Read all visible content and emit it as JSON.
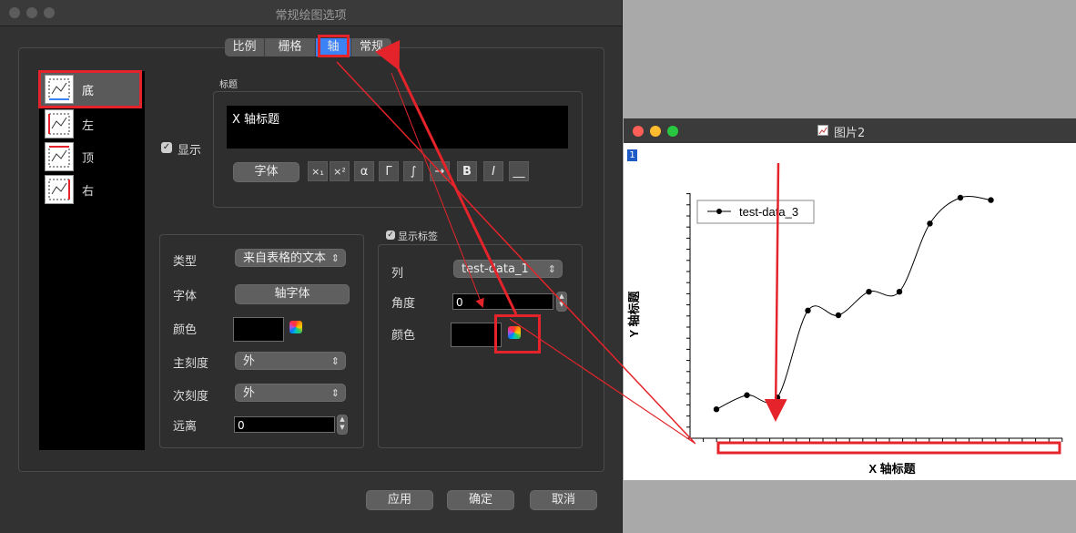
{
  "dialog": {
    "title": "常规绘图选项",
    "tabs": [
      {
        "label": "比例"
      },
      {
        "label": "栅格"
      },
      {
        "label": "轴",
        "selected": true
      },
      {
        "label": "常规"
      }
    ],
    "axes": [
      {
        "label": "底",
        "selected": true
      },
      {
        "label": "左"
      },
      {
        "label": "顶"
      },
      {
        "label": "右"
      }
    ],
    "show_checkbox": {
      "checked": true,
      "label": "显示"
    },
    "title_section": {
      "label": "标题",
      "text": "X 轴标题",
      "font_button": "字体",
      "toolbar": [
        "×₁",
        "×²",
        "α",
        "Γ",
        "∫",
        "→",
        "B",
        "I",
        "__"
      ]
    },
    "axis_props": {
      "type_label": "类型",
      "type_value": "来自表格的文本",
      "font_label": "字体",
      "font_button": "轴字体",
      "color_label": "颜色",
      "major_label": "主刻度",
      "major_value": "外",
      "minor_label": "次刻度",
      "minor_value": "外",
      "distance_label": "远离",
      "distance_value": "0"
    },
    "labels_section": {
      "checkbox_label": "显示标签",
      "checked": true,
      "column_label": "列",
      "column_value": "test-data_1",
      "angle_label": "角度",
      "angle_value": "0",
      "color_label": "颜色"
    },
    "footer": {
      "apply": "应用",
      "ok": "确定",
      "cancel": "取消"
    }
  },
  "plot_window": {
    "title": "图片2",
    "layer_badge": "1",
    "chart_data": {
      "type": "line",
      "title": "",
      "xlabel": "X 轴标题",
      "ylabel": "Y 轴标题",
      "legend": "top-left",
      "series": [
        {
          "name": "test-data_3",
          "x": [
            1,
            2,
            3,
            4,
            5,
            6,
            7,
            8,
            9,
            10
          ],
          "values": [
            0.1,
            0.16,
            0.15,
            0.52,
            0.5,
            0.6,
            0.6,
            0.89,
            1.0,
            0.99
          ]
        }
      ]
    }
  },
  "colors": {
    "annotation_red": "#e4242a",
    "dialog_bg": "#323232",
    "desktop_bg": "#a9a9a9"
  }
}
